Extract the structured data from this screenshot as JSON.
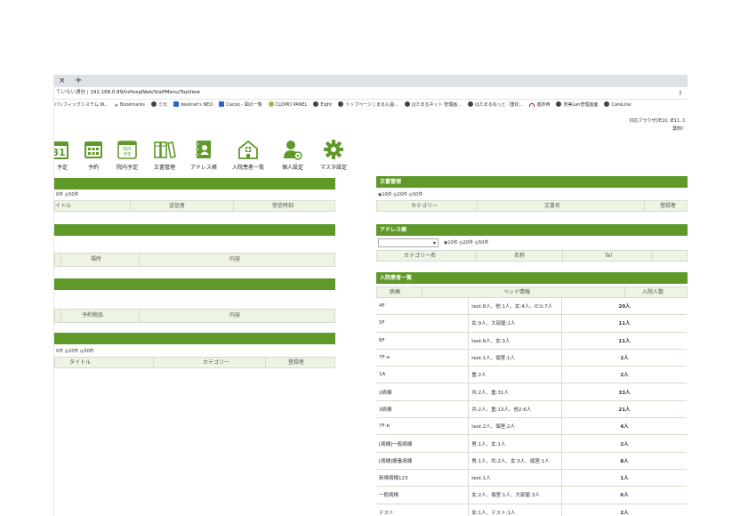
{
  "browser": {
    "tab_close": "×",
    "tab_new": "+",
    "security": "ていない通信",
    "url": "192.168.0.89/InHospWeb/StaffMenu/TopView",
    "key_icon": "key-icon",
    "bookmarks": [
      "パシフィックシステム W...",
      "Bookmarks",
      "ミ元",
      "desknet's NEO",
      "Cacoo - 図の一覧",
      "CLOMO PANEL",
      "Eight",
      "トップページ | まるん温...",
      "はたまるネット 管理画...",
      "はたまるねっと（重松...",
      "進捗用",
      "奈美Lan管理画面",
      "CareLine"
    ]
  },
  "header": {
    "browser_note": "対応ブラウザ[IE10, IE11, C",
    "user": "葉剤ﾄﾞ"
  },
  "toolbar": {
    "calendar_day": "31",
    "items": [
      "予定",
      "予約",
      "院内予定",
      "文書管理",
      "アドレス帳",
      "入院患者一覧",
      "個人設定",
      "マスタ設定"
    ],
    "doc_icon_text": "院内\n予定"
  },
  "left": {
    "p1": {
      "radio": "0件 ◎50件",
      "cols": [
        "イトル",
        "送信者",
        "受信時刻"
      ]
    },
    "p2": {
      "cols": [
        "場所",
        "内容"
      ]
    },
    "p3": {
      "cols": [
        "予約物品",
        "内容"
      ]
    },
    "p4": {
      "radio": "0件 ◎20件 ◎50件",
      "cols": [
        "タイトル",
        "カテゴリー",
        "登録者"
      ]
    }
  },
  "right": {
    "docs": {
      "title": "文書管理",
      "radio": "◉10件 ◎20件 ◎50件",
      "cols": [
        "カテゴリー",
        "文書名",
        "登録者"
      ]
    },
    "address": {
      "title": "アドレス帳",
      "radio": "◉10件 ◎20件 ◎50件",
      "cols": [
        "カテゴリー名",
        "名称",
        "Tel"
      ]
    },
    "patients": {
      "title": "入院患者一覧",
      "cols": [
        "病棟",
        "ベッド情報",
        "入院人数"
      ],
      "rows": [
        {
          "ward": "4F",
          "bed": "test:8人、他:1人、女:4人、ICU:7人",
          "count": "20人"
        },
        {
          "ward": "5F",
          "bed": "女:9人、大部屋:2人",
          "count": "11人"
        },
        {
          "ward": "6F",
          "bed": "test:8人、女:3人",
          "count": "11人"
        },
        {
          "ward": "7F-a",
          "bed": "test:1人、個室:1人",
          "count": "2人"
        },
        {
          "ward": "1A",
          "bed": "重:2人",
          "count": "2人"
        },
        {
          "ward": "2病棟",
          "bed": "共:2人、重:31人",
          "count": "33人"
        },
        {
          "ward": "3病棟",
          "bed": "共:2人、重:13人、他2:6人",
          "count": "21人"
        },
        {
          "ward": "7F-b",
          "bed": "test:2人、個室:2人",
          "count": "4人"
        },
        {
          "ward": "[病棟]一般病棟",
          "bed": "男:1人、女:1人",
          "count": "2人"
        },
        {
          "ward": "[病棟]療養病棟",
          "bed": "男:1人、共:2人、女:3人、個室:1人",
          "count": "8人"
        },
        {
          "ward": "新規病棟123",
          "bed": "test:1人",
          "count": "1人"
        },
        {
          "ward": "一般病棟",
          "bed": "女:2人、個室:1人、大部屋:3人",
          "count": "6人"
        },
        {
          "ward": "テスト",
          "bed": "女:1人、テスト:1人",
          "count": "2人"
        }
      ]
    }
  },
  "colors": {
    "accent": "#5f9929",
    "header_bg": "#eef4e4"
  }
}
